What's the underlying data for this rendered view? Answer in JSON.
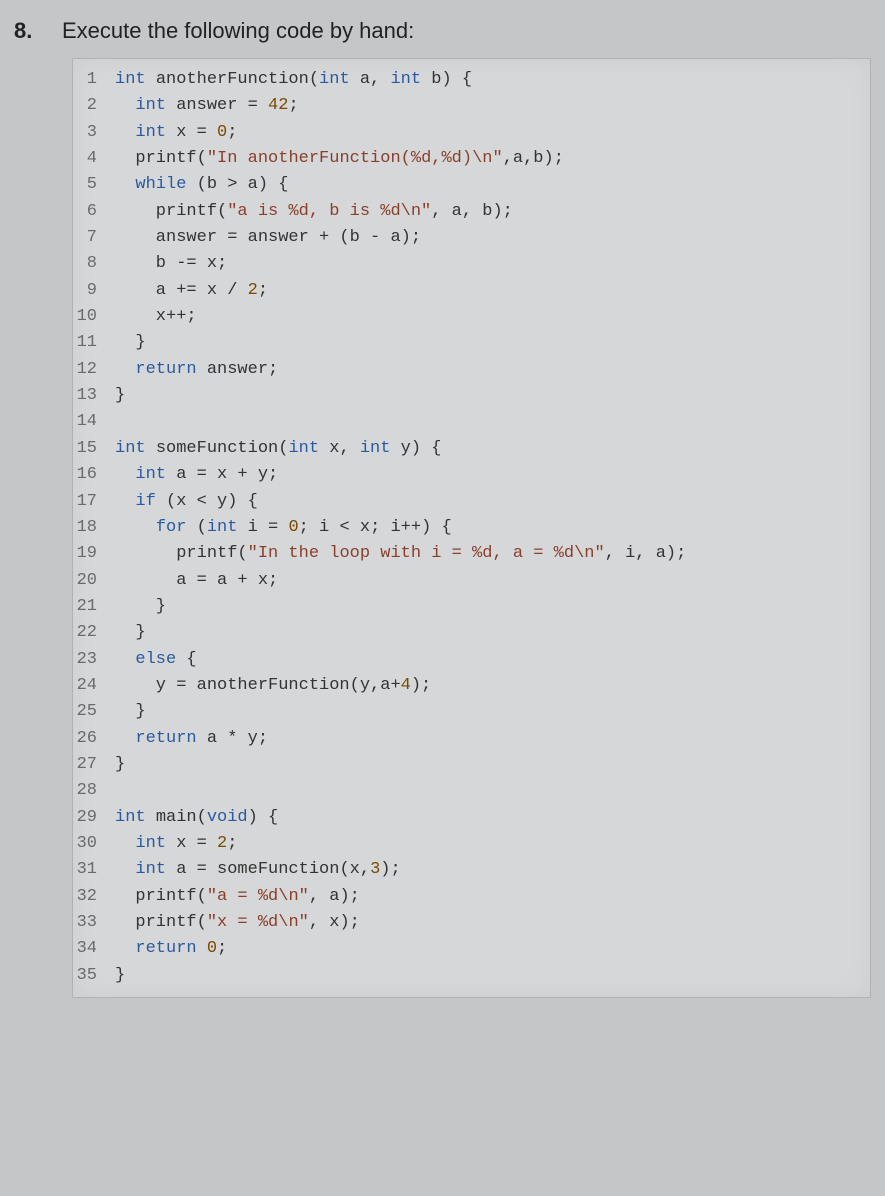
{
  "question": {
    "number": "8.",
    "prompt": "Execute the following code by hand:"
  },
  "code": {
    "lines": [
      {
        "n": "1",
        "tokens": [
          [
            "kw",
            "int "
          ],
          [
            "pl",
            "anotherFunction("
          ],
          [
            "kw",
            "int "
          ],
          [
            "pl",
            "a, "
          ],
          [
            "kw",
            "int "
          ],
          [
            "pl",
            "b) {"
          ]
        ]
      },
      {
        "n": "2",
        "tokens": [
          [
            "pl",
            "  "
          ],
          [
            "kw",
            "int "
          ],
          [
            "pl",
            "answer = "
          ],
          [
            "num",
            "42"
          ],
          [
            "pl",
            ";"
          ]
        ]
      },
      {
        "n": "3",
        "tokens": [
          [
            "pl",
            "  "
          ],
          [
            "kw",
            "int "
          ],
          [
            "pl",
            "x = "
          ],
          [
            "num",
            "0"
          ],
          [
            "pl",
            ";"
          ]
        ]
      },
      {
        "n": "4",
        "tokens": [
          [
            "pl",
            "  printf("
          ],
          [
            "str",
            "\"In anotherFunction(%d,%d)\\n\""
          ],
          [
            "pl",
            ",a,b);"
          ]
        ]
      },
      {
        "n": "5",
        "tokens": [
          [
            "pl",
            "  "
          ],
          [
            "kw",
            "while "
          ],
          [
            "pl",
            "(b > a) {"
          ]
        ]
      },
      {
        "n": "6",
        "tokens": [
          [
            "pl",
            "    printf("
          ],
          [
            "str",
            "\"a is %d, b is %d\\n\""
          ],
          [
            "pl",
            ", a, b);"
          ]
        ]
      },
      {
        "n": "7",
        "tokens": [
          [
            "pl",
            "    answer = answer + (b - a);"
          ]
        ]
      },
      {
        "n": "8",
        "tokens": [
          [
            "pl",
            "    b -= x;"
          ]
        ]
      },
      {
        "n": "9",
        "tokens": [
          [
            "pl",
            "    a += x / "
          ],
          [
            "num",
            "2"
          ],
          [
            "pl",
            ";"
          ]
        ]
      },
      {
        "n": "10",
        "tokens": [
          [
            "pl",
            "    x++;"
          ]
        ]
      },
      {
        "n": "11",
        "tokens": [
          [
            "pl",
            "  }"
          ]
        ]
      },
      {
        "n": "12",
        "tokens": [
          [
            "pl",
            "  "
          ],
          [
            "kw",
            "return "
          ],
          [
            "pl",
            "answer;"
          ]
        ]
      },
      {
        "n": "13",
        "tokens": [
          [
            "pl",
            "}"
          ]
        ]
      },
      {
        "n": "14",
        "tokens": [
          [
            "pl",
            ""
          ]
        ]
      },
      {
        "n": "15",
        "tokens": [
          [
            "kw",
            "int "
          ],
          [
            "pl",
            "someFunction("
          ],
          [
            "kw",
            "int "
          ],
          [
            "pl",
            "x, "
          ],
          [
            "kw",
            "int "
          ],
          [
            "pl",
            "y) {"
          ]
        ]
      },
      {
        "n": "16",
        "tokens": [
          [
            "pl",
            "  "
          ],
          [
            "kw",
            "int "
          ],
          [
            "pl",
            "a = x + y;"
          ]
        ]
      },
      {
        "n": "17",
        "tokens": [
          [
            "pl",
            "  "
          ],
          [
            "kw",
            "if "
          ],
          [
            "pl",
            "(x < y) {"
          ]
        ]
      },
      {
        "n": "18",
        "tokens": [
          [
            "pl",
            "    "
          ],
          [
            "kw",
            "for "
          ],
          [
            "pl",
            "("
          ],
          [
            "kw",
            "int "
          ],
          [
            "pl",
            "i = "
          ],
          [
            "num",
            "0"
          ],
          [
            "pl",
            "; i < x; i++) {"
          ]
        ]
      },
      {
        "n": "19",
        "tokens": [
          [
            "pl",
            "      printf("
          ],
          [
            "str",
            "\"In the loop with i = %d, a = %d\\n\""
          ],
          [
            "pl",
            ", i, a);"
          ]
        ]
      },
      {
        "n": "20",
        "tokens": [
          [
            "pl",
            "      a = a + x;"
          ]
        ]
      },
      {
        "n": "21",
        "tokens": [
          [
            "pl",
            "    }"
          ]
        ]
      },
      {
        "n": "22",
        "tokens": [
          [
            "pl",
            "  }"
          ]
        ]
      },
      {
        "n": "23",
        "tokens": [
          [
            "pl",
            "  "
          ],
          [
            "kw",
            "else "
          ],
          [
            "pl",
            "{"
          ]
        ]
      },
      {
        "n": "24",
        "tokens": [
          [
            "pl",
            "    y = anotherFunction(y,a+"
          ],
          [
            "num",
            "4"
          ],
          [
            "pl",
            ");"
          ]
        ]
      },
      {
        "n": "25",
        "tokens": [
          [
            "pl",
            "  }"
          ]
        ]
      },
      {
        "n": "26",
        "tokens": [
          [
            "pl",
            "  "
          ],
          [
            "kw",
            "return "
          ],
          [
            "pl",
            "a * y;"
          ]
        ]
      },
      {
        "n": "27",
        "tokens": [
          [
            "pl",
            "}"
          ]
        ]
      },
      {
        "n": "28",
        "tokens": [
          [
            "pl",
            ""
          ]
        ]
      },
      {
        "n": "29",
        "tokens": [
          [
            "kw",
            "int "
          ],
          [
            "pl",
            "main("
          ],
          [
            "kw",
            "void"
          ],
          [
            "pl",
            ") {"
          ]
        ]
      },
      {
        "n": "30",
        "tokens": [
          [
            "pl",
            "  "
          ],
          [
            "kw",
            "int "
          ],
          [
            "pl",
            "x = "
          ],
          [
            "num",
            "2"
          ],
          [
            "pl",
            ";"
          ]
        ]
      },
      {
        "n": "31",
        "tokens": [
          [
            "pl",
            "  "
          ],
          [
            "kw",
            "int "
          ],
          [
            "pl",
            "a = someFunction(x,"
          ],
          [
            "num",
            "3"
          ],
          [
            "pl",
            ");"
          ]
        ]
      },
      {
        "n": "32",
        "tokens": [
          [
            "pl",
            "  printf("
          ],
          [
            "str",
            "\"a = %d\\n\""
          ],
          [
            "pl",
            ", a);"
          ]
        ]
      },
      {
        "n": "33",
        "tokens": [
          [
            "pl",
            "  printf("
          ],
          [
            "str",
            "\"x = %d\\n\""
          ],
          [
            "pl",
            ", x);"
          ]
        ]
      },
      {
        "n": "34",
        "tokens": [
          [
            "pl",
            "  "
          ],
          [
            "kw",
            "return "
          ],
          [
            "num",
            "0"
          ],
          [
            "pl",
            ";"
          ]
        ]
      },
      {
        "n": "35",
        "tokens": [
          [
            "pl",
            "}"
          ]
        ]
      }
    ]
  }
}
